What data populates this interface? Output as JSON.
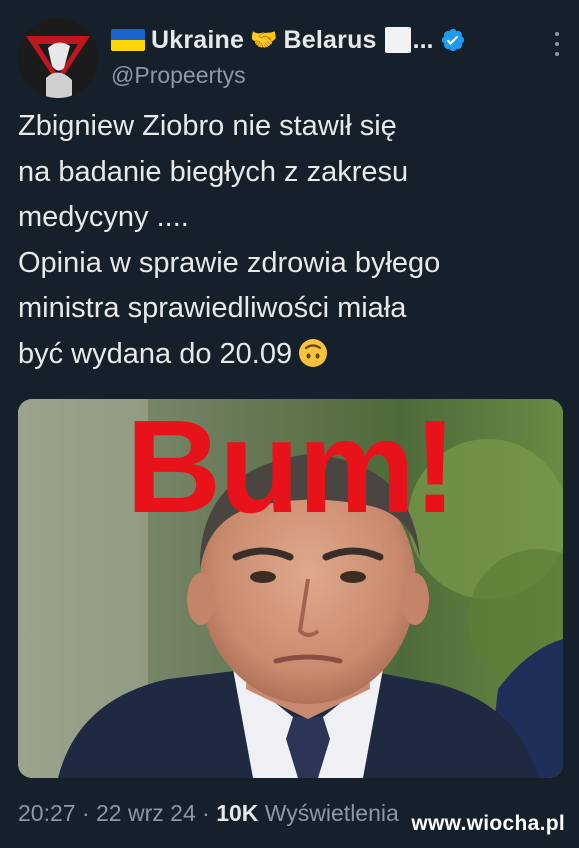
{
  "author": {
    "display_name_1": "Ukraine",
    "display_name_2": "Belarus",
    "display_name_suffix": "...",
    "handle": "@Propeertys",
    "icons": [
      "ukraine-flag-icon",
      "handshake-icon",
      "white-square-icon",
      "verified-badge-icon"
    ]
  },
  "tweet": {
    "lines": [
      "Zbigniew Ziobro nie stawił się",
      "na badanie biegłych z zakresu",
      "medycyny ....",
      "Opinia w sprawie zdrowia byłego",
      "ministra sprawiedliwości miała",
      "być wydana do 20.09"
    ],
    "emoji": "upside-down-face-icon"
  },
  "media": {
    "overlay_text": "Bum!"
  },
  "meta": {
    "time": "20:27",
    "sep1": " · ",
    "date": "22 wrz 24",
    "sep2": " · ",
    "views_count": "10K",
    "views_label": " Wyświetlenia"
  },
  "watermark": "www.wiocha.pl",
  "colors": {
    "background": "#15202b",
    "text": "#e7e9ea",
    "secondary": "#8b98a5",
    "verified": "#1d9bf0",
    "overlay_red": "#e8121a"
  }
}
